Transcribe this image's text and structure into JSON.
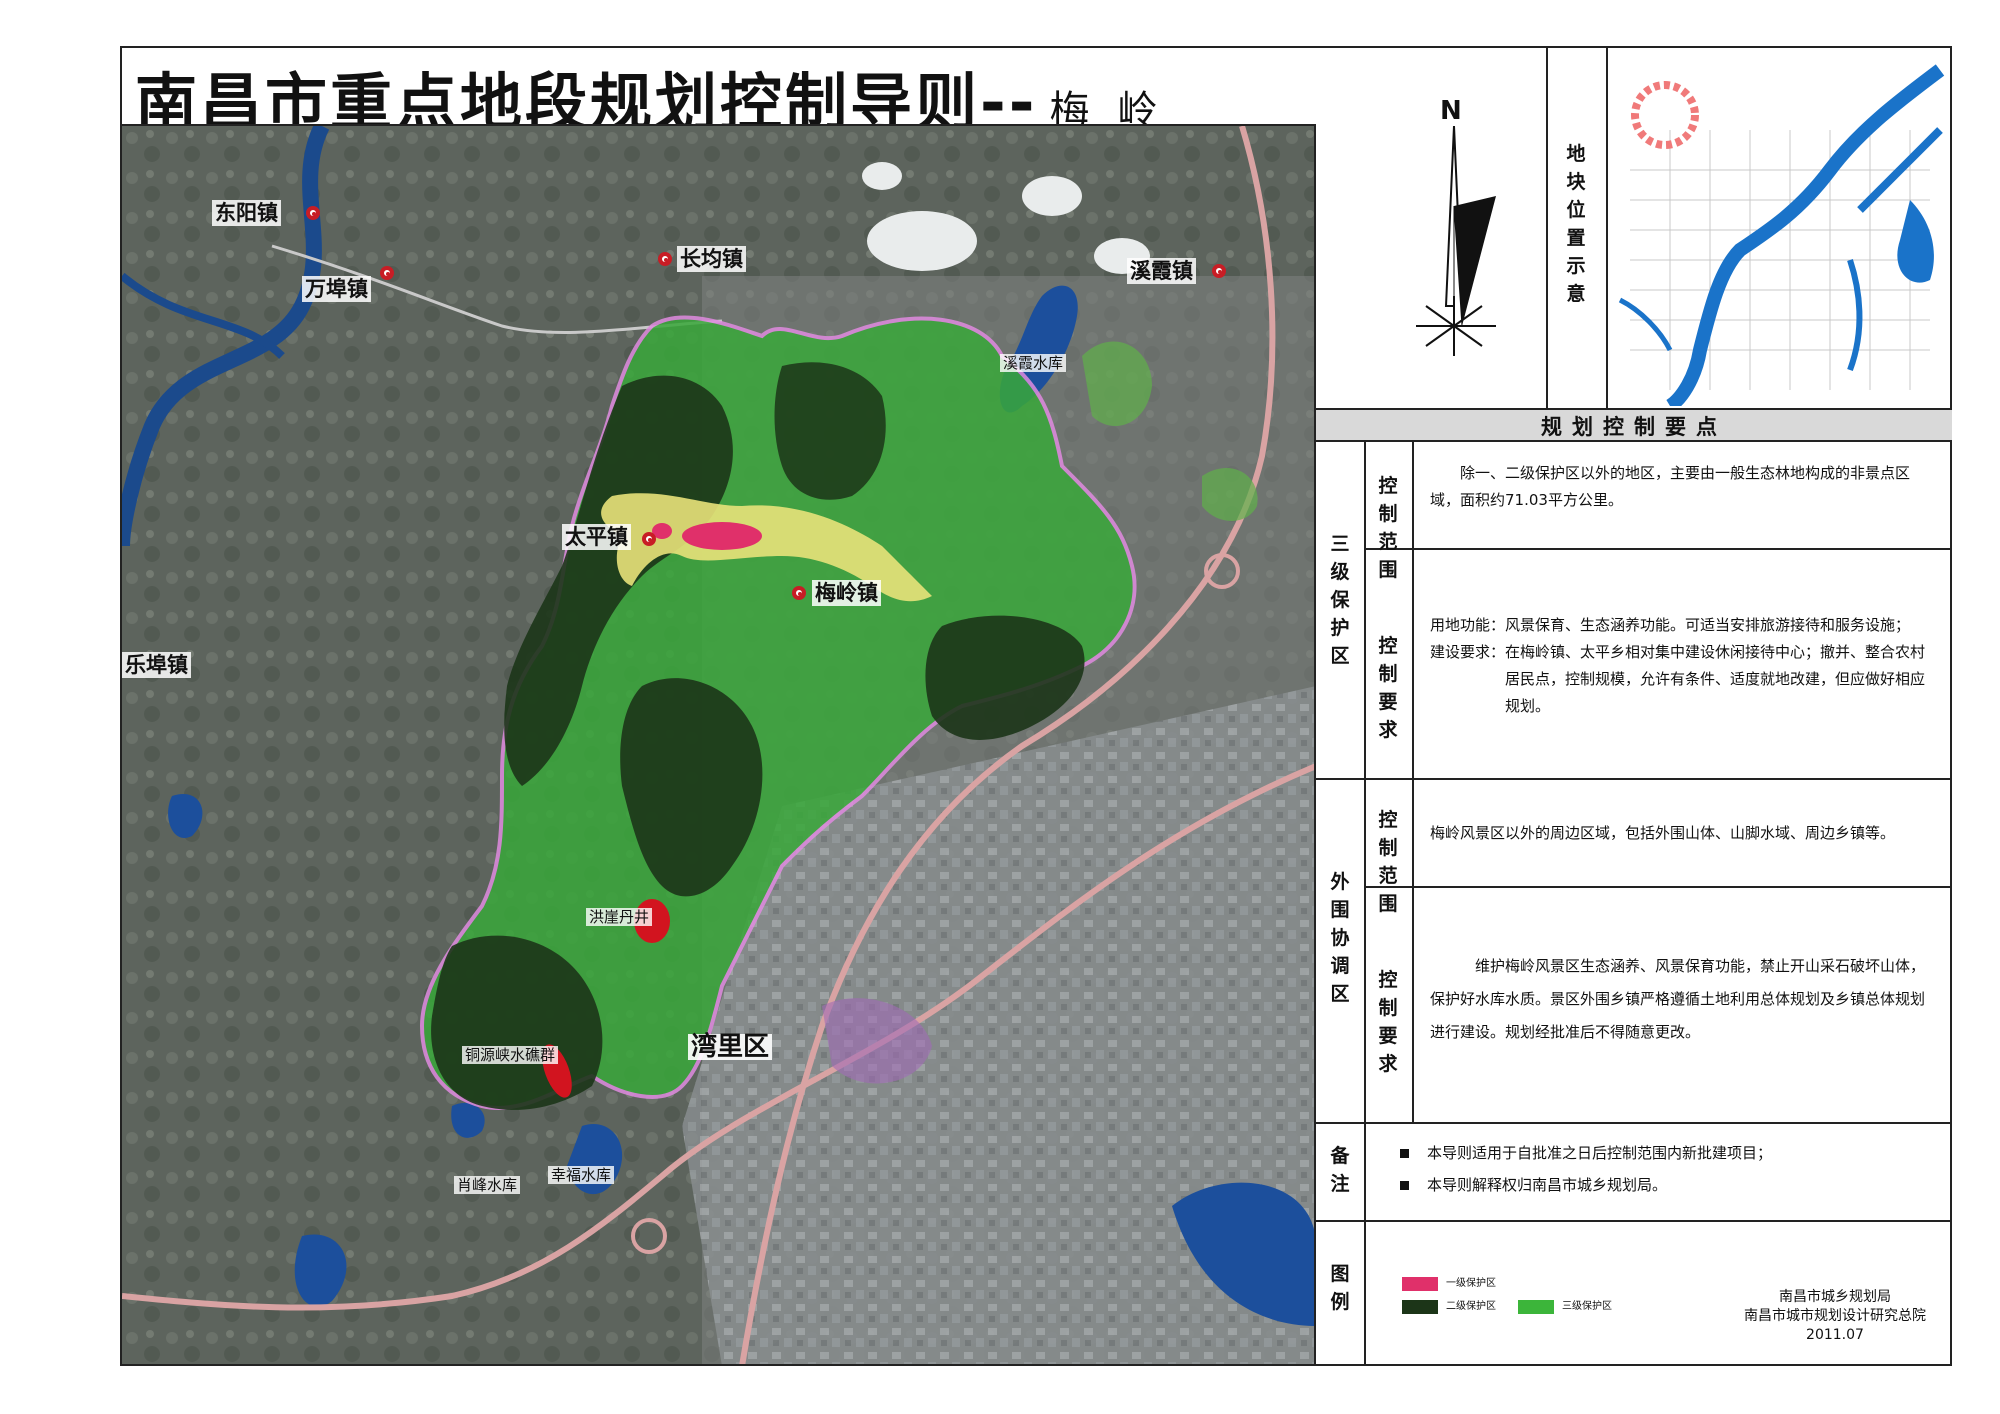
{
  "title": {
    "main": "南昌市重点地段规划控制导则--",
    "sub": "梅岭"
  },
  "compass": {
    "label": "N"
  },
  "locator": {
    "caption": "地块位置示意"
  },
  "map_labels": {
    "dongyang": "东阳镇",
    "wanbu": "万埠镇",
    "changjun": "长均镇",
    "xixia": "溪霞镇",
    "xixia_res": "溪霞水库",
    "taiping": "太平镇",
    "meiling": "梅岭镇",
    "lebu": "乐埠镇",
    "hongya": "洪崖丹井",
    "tongyuan": "铜源峡水礁群",
    "wanli": "湾里区",
    "xiaofeng": "肖峰水库",
    "xingfu": "幸福水库"
  },
  "panel": {
    "header": "规划控制要点",
    "zone3": {
      "label": "三级保护区",
      "range_label": "控制范围",
      "range_text": "除一、二级保护区以外的地区，主要由一般生态林地构成的非景点区域，面积约71.03平方公里。",
      "req_label": "控制要求",
      "req_line1": "用地功能：风景保育、生态涵养功能。可适当安排旅游接待和服务设施；",
      "req_line2": "建设要求：在梅岭镇、太平乡相对集中建设休闲接待中心；撤并、整合农村居民点，控制规模，允许有条件、适度就地改建，但应做好相应规划。"
    },
    "outer": {
      "label": "外围协调区",
      "range_label": "控制范围",
      "range_text": "梅岭风景区以外的周边区域，包括外围山体、山脚水域、周边乡镇等。",
      "req_label": "控制要求",
      "req_text": "维护梅岭风景区生态涵养、风景保育功能，禁止开山采石破坏山体，保护好水库水质。景区外围乡镇严格遵循土地利用总体规划及乡镇总体规划进行建设。规划经批准后不得随意更改。"
    },
    "notes": {
      "label": "备注",
      "n1": "本导则适用于自批准之日后控制范围内新批建项目；",
      "n2": "本导则解释权归南昌市城乡规划局。"
    },
    "legend": {
      "label": "图例",
      "l1": "一级保护区",
      "l2": "二级保护区",
      "l3": "三级保护区",
      "c1": "#e0306a",
      "c2": "#1c3518",
      "c3": "#3cb53a"
    },
    "org": {
      "line1": "南昌市城乡规划局",
      "line2": "南昌市城市规划设计研究总院",
      "date": "2011.07"
    }
  }
}
